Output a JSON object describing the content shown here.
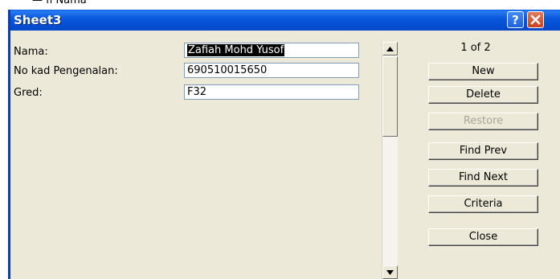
{
  "background_peek": "— fi Nama",
  "window": {
    "title": "Sheet3",
    "help_icon": "question-icon",
    "close_icon": "close-icon"
  },
  "fields": [
    {
      "label": "Nama:",
      "value": "Zafiah Mohd Yusof",
      "selected": true
    },
    {
      "label": "No kad Pengenalan:",
      "value": "690510015650",
      "selected": false
    },
    {
      "label": "Gred:",
      "value": "F32",
      "selected": false
    }
  ],
  "record_count": "1 of 2",
  "buttons": [
    {
      "label": "New",
      "enabled": true
    },
    {
      "label": "Delete",
      "enabled": true
    },
    {
      "label": "Restore",
      "enabled": false
    },
    {
      "label": "Find Prev",
      "enabled": true
    },
    {
      "label": "Find Next",
      "enabled": true
    },
    {
      "label": "Criteria",
      "enabled": true
    },
    {
      "label": "Close",
      "enabled": true
    }
  ],
  "colors": {
    "titlebar": "#0550d5",
    "dialog_bg": "#ece9d8",
    "close_button": "#c8401f"
  }
}
